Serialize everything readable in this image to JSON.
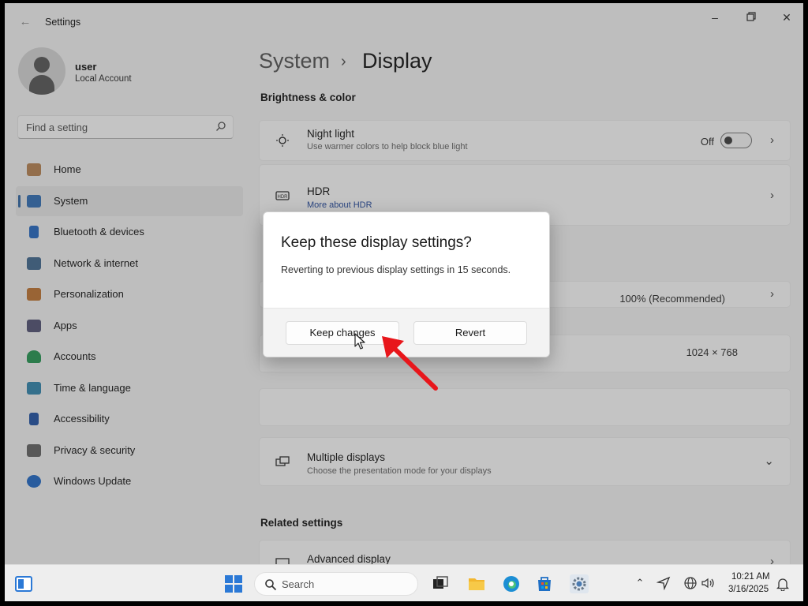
{
  "window": {
    "app_title": "Settings",
    "back_icon": "back-arrow-icon",
    "controls": [
      "minimize-icon",
      "maximize-icon",
      "close-icon"
    ]
  },
  "sidebar": {
    "user_name": "user",
    "account_type": "Local Account",
    "search_placeholder": "Find a setting",
    "items": [
      {
        "label": "Home",
        "icon": "home-icon",
        "color": "#b9885a"
      },
      {
        "label": "System",
        "icon": "system-icon",
        "color": "#3a74b8",
        "selected": true
      },
      {
        "label": "Bluetooth & devices",
        "icon": "bluetooth-icon",
        "color": "#2e6fc4"
      },
      {
        "label": "Network & internet",
        "icon": "network-icon",
        "color": "#4a6f94"
      },
      {
        "label": "Personalization",
        "icon": "personalization-icon",
        "color": "#c27a3a"
      },
      {
        "label": "Apps",
        "icon": "apps-icon",
        "color": "#5a5a7a"
      },
      {
        "label": "Accounts",
        "icon": "accounts-icon",
        "color": "#2e9a5a"
      },
      {
        "label": "Time & language",
        "icon": "time-language-icon",
        "color": "#3a8ab0"
      },
      {
        "label": "Accessibility",
        "icon": "accessibility-icon",
        "color": "#2a5aa8"
      },
      {
        "label": "Privacy & security",
        "icon": "privacy-security-icon",
        "color": "#6a6a6a"
      },
      {
        "label": "Windows Update",
        "icon": "windows-update-icon",
        "color": "#2a6fc8"
      }
    ]
  },
  "content": {
    "breadcrumb_parent": "System",
    "breadcrumb_current": "Display",
    "section_brightness": "Brightness & color",
    "night_light": {
      "title": "Night light",
      "subtitle": "Use warmer colors to help block blue light",
      "state": "Off"
    },
    "hdr": {
      "title": "HDR",
      "link": "More about HDR"
    },
    "scale_value": "100% (Recommended)",
    "resolution_value": "1024 × 768",
    "multiple_displays": {
      "title": "Multiple displays",
      "subtitle": "Choose the presentation mode for your displays"
    },
    "section_related": "Related settings",
    "advanced_display": "Advanced display"
  },
  "dialog": {
    "title": "Keep these display settings?",
    "message": "Reverting to previous display settings in 15 seconds.",
    "keep_label": "Keep changes",
    "revert_label": "Revert"
  },
  "taskbar": {
    "search_label": "Search",
    "time": "10:21 AM",
    "date": "3/16/2025",
    "accent": "#2b79d6"
  }
}
